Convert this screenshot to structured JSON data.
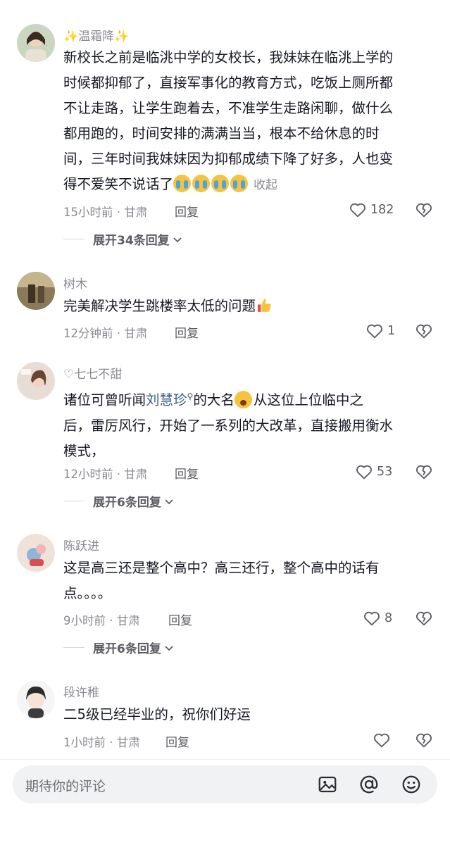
{
  "comments": [
    {
      "username": "✨温霜降✨",
      "text_lines": [
        "新校长之前是临洮中学的女校长，我妹妹在临洮上学的",
        "时候都抑郁了，直接军事化的教育方式，吃饭上厕所都",
        "不让走路，让学生跑着去，不准学生走路闲聊，做什么",
        "都用跑的，时间安排的满满当当，根本不给休息的时",
        "间，三年时间我妹妹因为抑郁成绩下降了好多，人也变",
        "得不爱笑不说话了"
      ],
      "collapse_label": "收起",
      "time_location": "15小时前 · 甘肃",
      "reply_label": "回复",
      "likes": "182",
      "expand_label": "展开34条回复"
    },
    {
      "username": "树木",
      "text": "完美解决学生跳楼率太低的问题",
      "time_location": "12分钟前 · 甘肃",
      "reply_label": "回复",
      "likes": "1"
    },
    {
      "username": "♡七七不甜",
      "text_before": "诸位可曾听闻",
      "link_text": "刘慧珍",
      "text_after": "的大名",
      "text_after_emoji": "从这位上位临中之",
      "text_line2": "后，雷厉风行，开始了一系列的大改革，直接搬用衡水",
      "text_line3": "模式，",
      "time_location": "12小时前 · 甘肃",
      "reply_label": "回复",
      "likes": "53",
      "expand_label": "展开6条回复"
    },
    {
      "username": "陈跃进",
      "text_line1": "这是高三还是整个高中？高三还行，整个高中的话有",
      "text_line2": "点。。。。",
      "time_location": "9小时前 · 甘肃",
      "reply_label": "回复",
      "likes": "8",
      "expand_label": "展开6条回复"
    },
    {
      "username": "段许稚",
      "text": "二5级已经毕业的，祝你们好运",
      "time_location": "1小时前 · 甘肃",
      "reply_label": "回复"
    }
  ],
  "input": {
    "placeholder": "期待你的评论"
  },
  "icons": {
    "like": "heart-outline-icon",
    "dislike": "broken-heart-icon",
    "image": "image-icon",
    "mention": "at-icon",
    "emoji": "smile-icon",
    "expand": "chevron-down-icon"
  },
  "colors": {
    "text_primary": "#161823",
    "text_secondary": "#8a8b91",
    "link": "#3a5f8c",
    "input_bg": "#f1f2f4"
  }
}
